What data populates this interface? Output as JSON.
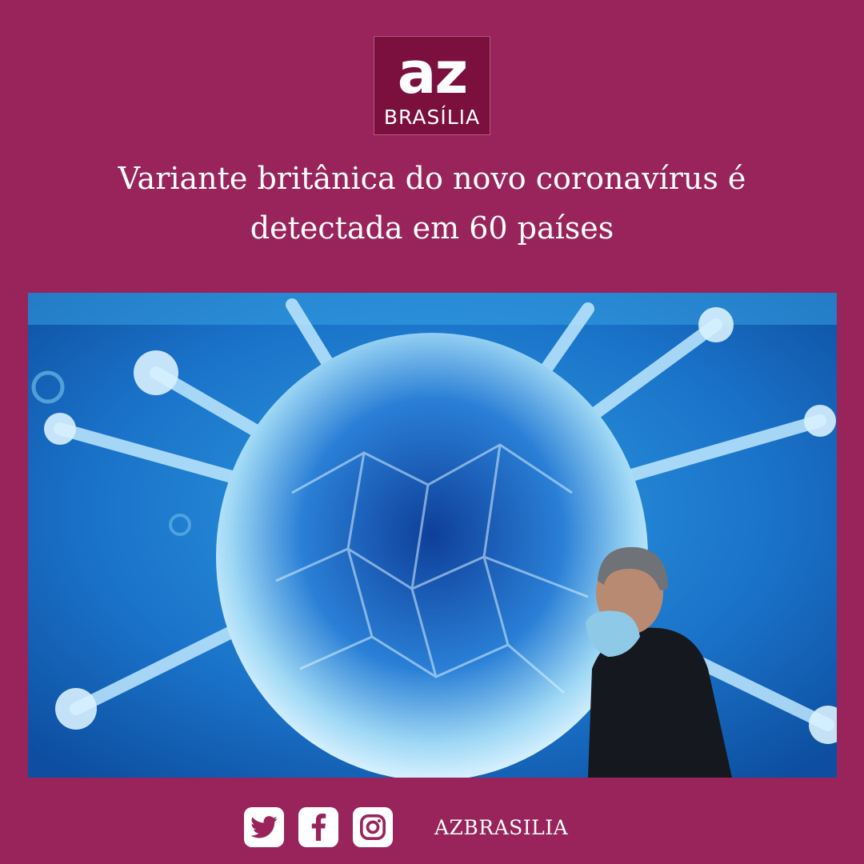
{
  "brand": {
    "logo_text": "az",
    "logo_subtitle": "BRASÍLIA"
  },
  "headline": "Variante britânica do novo coronavírus é detectada em 60 países",
  "image": {
    "subject": "photo-virus-mural-man-with-mask"
  },
  "footer": {
    "social_icons": [
      "twitter-icon",
      "facebook-icon",
      "instagram-icon"
    ],
    "handle": "AZBRASILIA"
  },
  "colors": {
    "background": "#98245b",
    "logo_bg": "#7b0f3d",
    "text": "#ffffff"
  }
}
